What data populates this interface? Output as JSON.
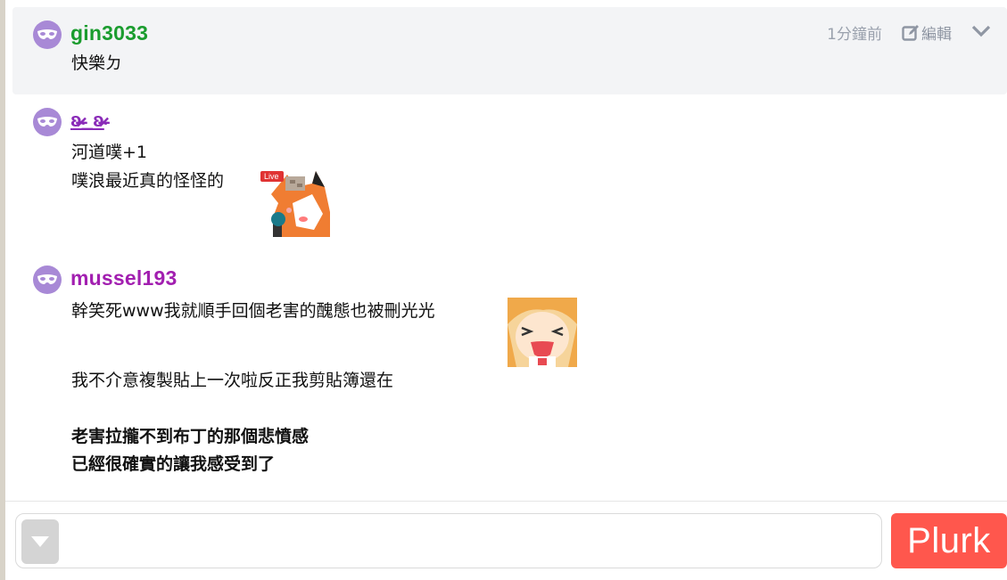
{
  "responses": [
    {
      "user": "gin3033",
      "name_color": "#1a9c2e",
      "time": "1分鐘前",
      "edit_label": "編輯",
      "lines": [
        "快樂ㄉ"
      ]
    },
    {
      "user": "ʚ̴̶̷̷_ʚ̴̶̷̷",
      "name_color": "#8a2bb8",
      "lines": [
        "河道噗+1",
        "噗浪最近真的怪怪的"
      ],
      "sticker_label": "Live"
    },
    {
      "user": "mussel193",
      "name_color": "#a21fb0",
      "lines": [
        "幹笑死www我就順手回個老害的醜態也被刪光光",
        "我不介意複製貼上一次啦反正我剪貼簿還在"
      ],
      "bold_lines": [
        "老害拉攏不到布丁的那個悲憤感",
        "已經很確實的讓我感受到了"
      ]
    }
  ],
  "composer": {
    "placeholder": "",
    "submit_label": "Plurk"
  },
  "colors": {
    "accent": "#ff574d",
    "avatar": "#a889d6"
  },
  "icons": [
    "mask-icon",
    "edit-icon",
    "chevron-down-icon",
    "qualifier-toggle-icon"
  ]
}
